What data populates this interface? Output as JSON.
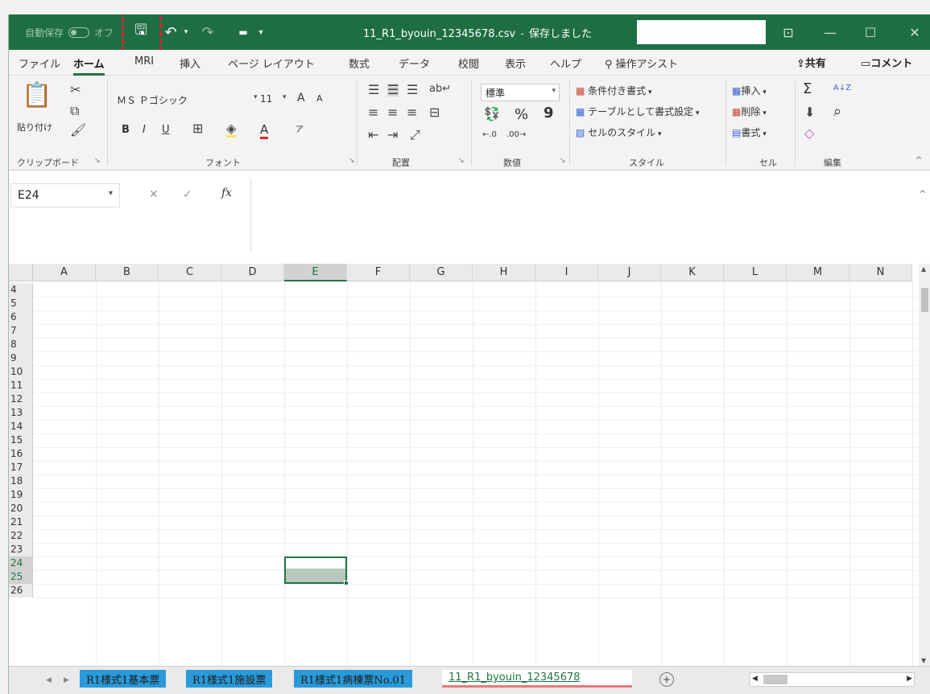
{
  "titlebar": {
    "autosave_label": "自動保存",
    "autosave_state": "オフ",
    "qat": {
      "save": "🖫",
      "undo": "↶",
      "redo": "↷",
      "customize": "▾"
    },
    "filename": "11_R1_byouin_12345678.csv",
    "separator": "-",
    "status": "保存しました",
    "controls": {
      "ribbon_display": "⊡",
      "minimize": "—",
      "maximize": "☐",
      "close": "✕"
    }
  },
  "tabs": [
    "ファイル",
    "ホーム",
    "MRI",
    "挿入",
    "ページ レイアウト",
    "数式",
    "データ",
    "校閲",
    "表示",
    "ヘルプ"
  ],
  "tell_me": "操作アシスト",
  "share": "共有",
  "comment": "コメント",
  "ribbon": {
    "clipboard": {
      "paste": "貼り付け",
      "label": "クリップボード"
    },
    "font": {
      "name": "ＭＳ Ｐゴシック",
      "size": "11",
      "grow": "A",
      "shrink": "A",
      "bold": "B",
      "italic": "I",
      "underline": "U",
      "font_color": "A",
      "phonetic": "ア",
      "label": "フォント"
    },
    "alignment": {
      "label": "配置"
    },
    "number": {
      "format": "標準",
      "percent": "%",
      "comma": "9",
      "label": "数値"
    },
    "styles": {
      "conditional": "条件付き書式",
      "table": "テーブルとして書式設定",
      "cell_styles": "セルのスタイル",
      "label": "スタイル"
    },
    "cells": {
      "insert": "挿入",
      "delete": "削除",
      "format": "書式",
      "label": "セル"
    },
    "editing": {
      "sum": "Σ",
      "sort": "A↓Z",
      "find": "⌕",
      "label": "編集"
    }
  },
  "formula_bar": {
    "name_box": "E24",
    "cancel": "✕",
    "enter": "✓",
    "fx": "fx",
    "content": ""
  },
  "columns": [
    "A",
    "B",
    "C",
    "D",
    "E",
    "F",
    "G",
    "H",
    "I",
    "J",
    "K",
    "L",
    "M",
    "N"
  ],
  "selected_column": "E",
  "rows": [
    "4",
    "5",
    "6",
    "7",
    "8",
    "9",
    "10",
    "11",
    "12",
    "13",
    "14",
    "15",
    "16",
    "17",
    "18",
    "19",
    "20",
    "21",
    "22",
    "23",
    "24",
    "25",
    "26"
  ],
  "selected_rows": [
    "24",
    "25"
  ],
  "sheets": [
    {
      "name": "R1様式1基本票",
      "style": "blue"
    },
    {
      "name": "R1様式1施設票",
      "style": "blue"
    },
    {
      "name": "R1様式1病棟票No.01",
      "style": "blue"
    },
    {
      "name": "11_R1_byouin_12345678",
      "style": "active"
    }
  ],
  "add_sheet": "+",
  "colors": {
    "excel_green": "#217346",
    "titlebar": "#1f6e43",
    "highlight": "#d2242a",
    "sheet_blue": "#2a9ad8"
  }
}
